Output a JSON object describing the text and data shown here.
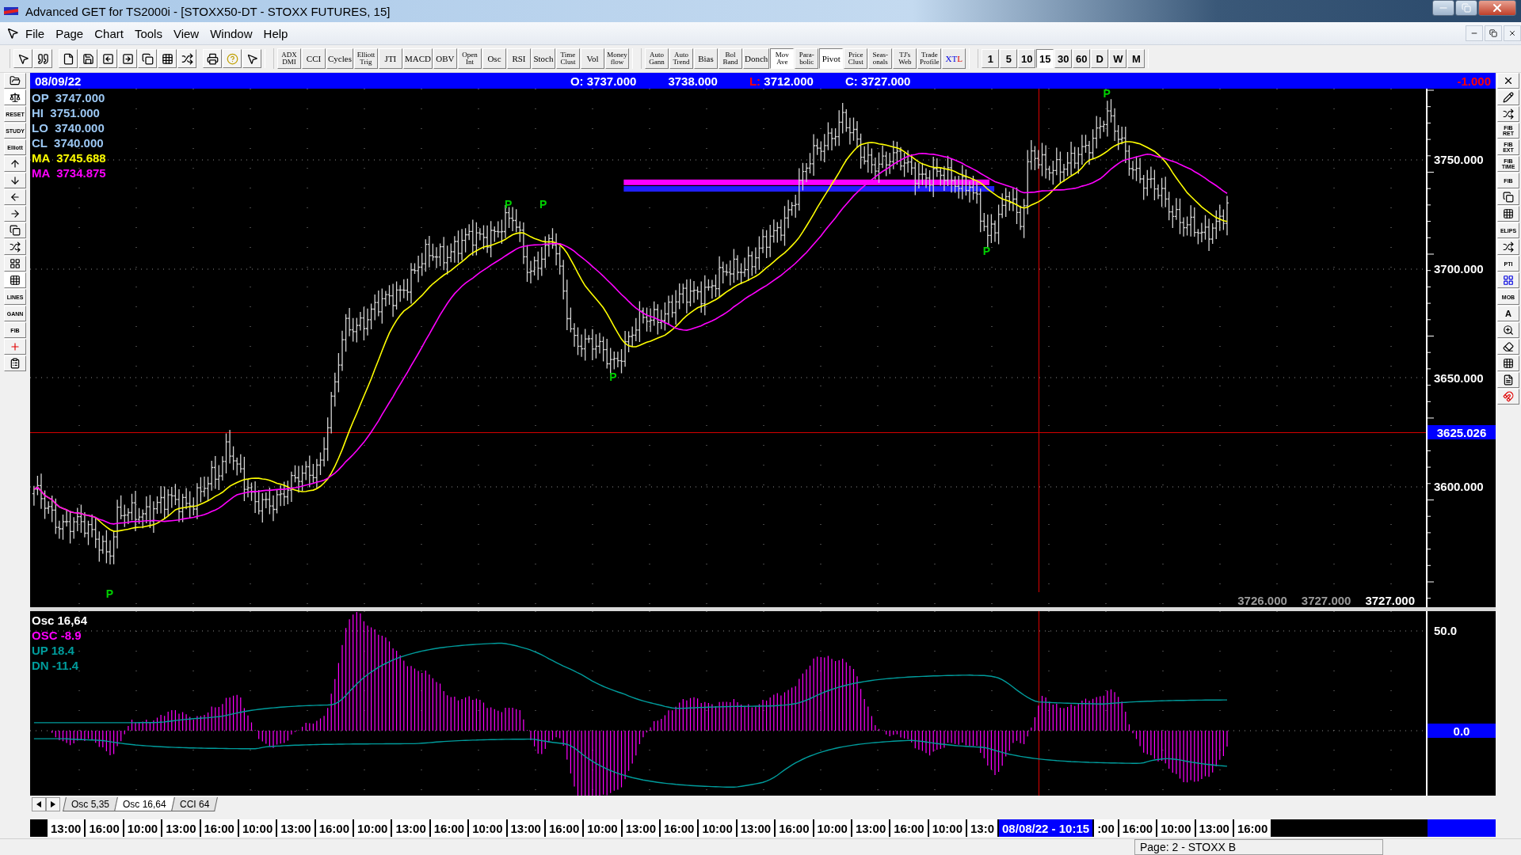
{
  "window": {
    "title": "Advanced GET for TS2000i - [STOXX50-DT - STOXX FUTURES, 15]"
  },
  "menu": [
    "File",
    "Page",
    "Chart",
    "Tools",
    "View",
    "Window",
    "Help"
  ],
  "indicator_buttons": [
    {
      "lines": [
        "ADX",
        "DMI"
      ],
      "pressed": false
    },
    {
      "lines": [
        "CCI"
      ],
      "pressed": false
    },
    {
      "lines": [
        "Cycles"
      ],
      "pressed": false
    },
    {
      "lines": [
        "Elliott",
        "Trig"
      ],
      "pressed": false
    },
    {
      "lines": [
        "JTI"
      ],
      "pressed": false
    },
    {
      "lines": [
        "MACD"
      ],
      "pressed": false
    },
    {
      "lines": [
        "OBV"
      ],
      "pressed": false
    },
    {
      "lines": [
        "Open",
        "Int"
      ],
      "pressed": false
    },
    {
      "lines": [
        "Osc"
      ],
      "pressed": false
    },
    {
      "lines": [
        "RSI"
      ],
      "pressed": false
    },
    {
      "lines": [
        "Stoch"
      ],
      "pressed": false
    },
    {
      "lines": [
        "Time",
        "Clust"
      ],
      "pressed": false
    },
    {
      "lines": [
        "Vol"
      ],
      "pressed": false
    },
    {
      "lines": [
        "Money",
        "flow"
      ],
      "pressed": false
    }
  ],
  "study_buttons": [
    {
      "lines": [
        "Auto",
        "Gann"
      ],
      "pressed": false
    },
    {
      "lines": [
        "Auto",
        "Trend"
      ],
      "pressed": false
    },
    {
      "lines": [
        "Bias"
      ],
      "pressed": false
    },
    {
      "lines": [
        "Bol",
        "Band"
      ],
      "pressed": false
    },
    {
      "lines": [
        "Donch"
      ],
      "pressed": false
    },
    {
      "lines": [
        "Mov",
        "Ave"
      ],
      "pressed": true
    },
    {
      "lines": [
        "Para-",
        "bolic"
      ],
      "pressed": false
    },
    {
      "lines": [
        "Pivot"
      ],
      "pressed": true
    },
    {
      "lines": [
        "Price",
        "Clust"
      ],
      "pressed": false
    },
    {
      "lines": [
        "Seas-",
        "onals"
      ],
      "pressed": false
    },
    {
      "lines": [
        "TJ's",
        "Web"
      ],
      "pressed": false
    },
    {
      "lines": [
        "Trade",
        "Profile"
      ],
      "pressed": false
    },
    {
      "lines": [
        "XTL"
      ],
      "pressed": false
    }
  ],
  "timeframes": [
    {
      "label": "1",
      "selected": false
    },
    {
      "label": "5",
      "selected": false
    },
    {
      "label": "10",
      "selected": false
    },
    {
      "label": "15",
      "selected": true
    },
    {
      "label": "30",
      "selected": false
    },
    {
      "label": "60",
      "selected": false
    },
    {
      "label": "D",
      "selected": false
    },
    {
      "label": "W",
      "selected": false
    },
    {
      "label": "M",
      "selected": false
    }
  ],
  "left_tools": [
    "RESET",
    "STUDY",
    "Elliott",
    "LINES",
    "GANN",
    "FIB"
  ],
  "right_tools": [
    "FIB RET",
    "FIB EXT",
    "FIB TIME",
    "FIB",
    "ELIPS",
    "PTI",
    "MOB",
    "A"
  ],
  "info_bar": {
    "date": "08/09/22",
    "prices": [
      {
        "label": "O:",
        "value": "3737.000",
        "kind": "plain"
      },
      {
        "value": "3738.000"
      },
      {
        "label": "L:",
        "value": "3712.000",
        "kind": "low"
      },
      {
        "label": "C:",
        "value": "3727.000",
        "kind": "plain"
      }
    ],
    "change": "-1.000"
  },
  "price_panel": {
    "legend": [
      {
        "label": "OP",
        "value": "3747.000",
        "color": "#9cc8f4"
      },
      {
        "label": "HI",
        "value": "3751.000",
        "color": "#9cc8f4"
      },
      {
        "label": "LO",
        "value": "3740.000",
        "color": "#9cc8f4"
      },
      {
        "label": "CL",
        "value": "3740.000",
        "color": "#9cc8f4"
      },
      {
        "label": "MA",
        "value": "3745.688",
        "color": "#ffff00"
      },
      {
        "label": "MA",
        "value": "3734.875",
        "color": "#ff00ff"
      }
    ],
    "pivot_marks": [
      "P",
      "P",
      "P",
      "P",
      "P",
      "P"
    ],
    "axis_labels": [
      "3750.000",
      "3700.000",
      "3650.000",
      "3600.000"
    ],
    "cursor_price": "3625.026",
    "footer_values": [
      {
        "value": "3726.000",
        "selected": false
      },
      {
        "value": "3727.000",
        "selected": false
      },
      {
        "value": "3727.000",
        "selected": true
      }
    ]
  },
  "osc_panel": {
    "title": "Osc 16,64",
    "legend": [
      {
        "label": "OSC",
        "value": "-8.9",
        "color": "#ff00ff"
      },
      {
        "label": "UP",
        "value": "18.4",
        "color": "#009c9c"
      },
      {
        "label": "DN",
        "value": "-11.4",
        "color": "#009c9c"
      }
    ],
    "axis_labels": [
      "50.0"
    ],
    "zero_label": "0.0"
  },
  "study_tabs": [
    {
      "label": "Osc 5,35",
      "selected": false
    },
    {
      "label": "Osc 16,64",
      "selected": true
    },
    {
      "label": "CCI 64",
      "selected": false
    }
  ],
  "time_axis": [
    {
      "label": "13:00",
      "selected": false
    },
    {
      "label": "16:00",
      "selected": false
    },
    {
      "label": "10:00",
      "selected": false
    },
    {
      "label": "13:00",
      "selected": false
    },
    {
      "label": "16:00",
      "selected": false
    },
    {
      "label": "10:00",
      "selected": false
    },
    {
      "label": "13:00",
      "selected": false
    },
    {
      "label": "16:00",
      "selected": false
    },
    {
      "label": "10:00",
      "selected": false
    },
    {
      "label": "13:00",
      "selected": false
    },
    {
      "label": "16:00",
      "selected": false
    },
    {
      "label": "10:00",
      "selected": false
    },
    {
      "label": "13:00",
      "selected": false
    },
    {
      "label": "16:00",
      "selected": false
    },
    {
      "label": "10:00",
      "selected": false
    },
    {
      "label": "13:00",
      "selected": false
    },
    {
      "label": "16:00",
      "selected": false
    },
    {
      "label": "10:00",
      "selected": false
    },
    {
      "label": "13:00",
      "selected": false
    },
    {
      "label": "16:00",
      "selected": false
    },
    {
      "label": "10:00",
      "selected": false
    },
    {
      "label": "13:00",
      "selected": false
    },
    {
      "label": "16:00",
      "selected": false
    },
    {
      "label": "10:00",
      "selected": false
    },
    {
      "label": "13:0",
      "selected": false
    },
    {
      "label": "08/08/22 - 10:15",
      "selected": true
    },
    {
      "label": ":00",
      "selected": false
    },
    {
      "label": "16:00",
      "selected": false
    },
    {
      "label": "10:00",
      "selected": false
    },
    {
      "label": "13:00",
      "selected": false
    },
    {
      "label": "16:00",
      "selected": false
    }
  ],
  "status_bar": "Page: 2 - STOXX B"
}
